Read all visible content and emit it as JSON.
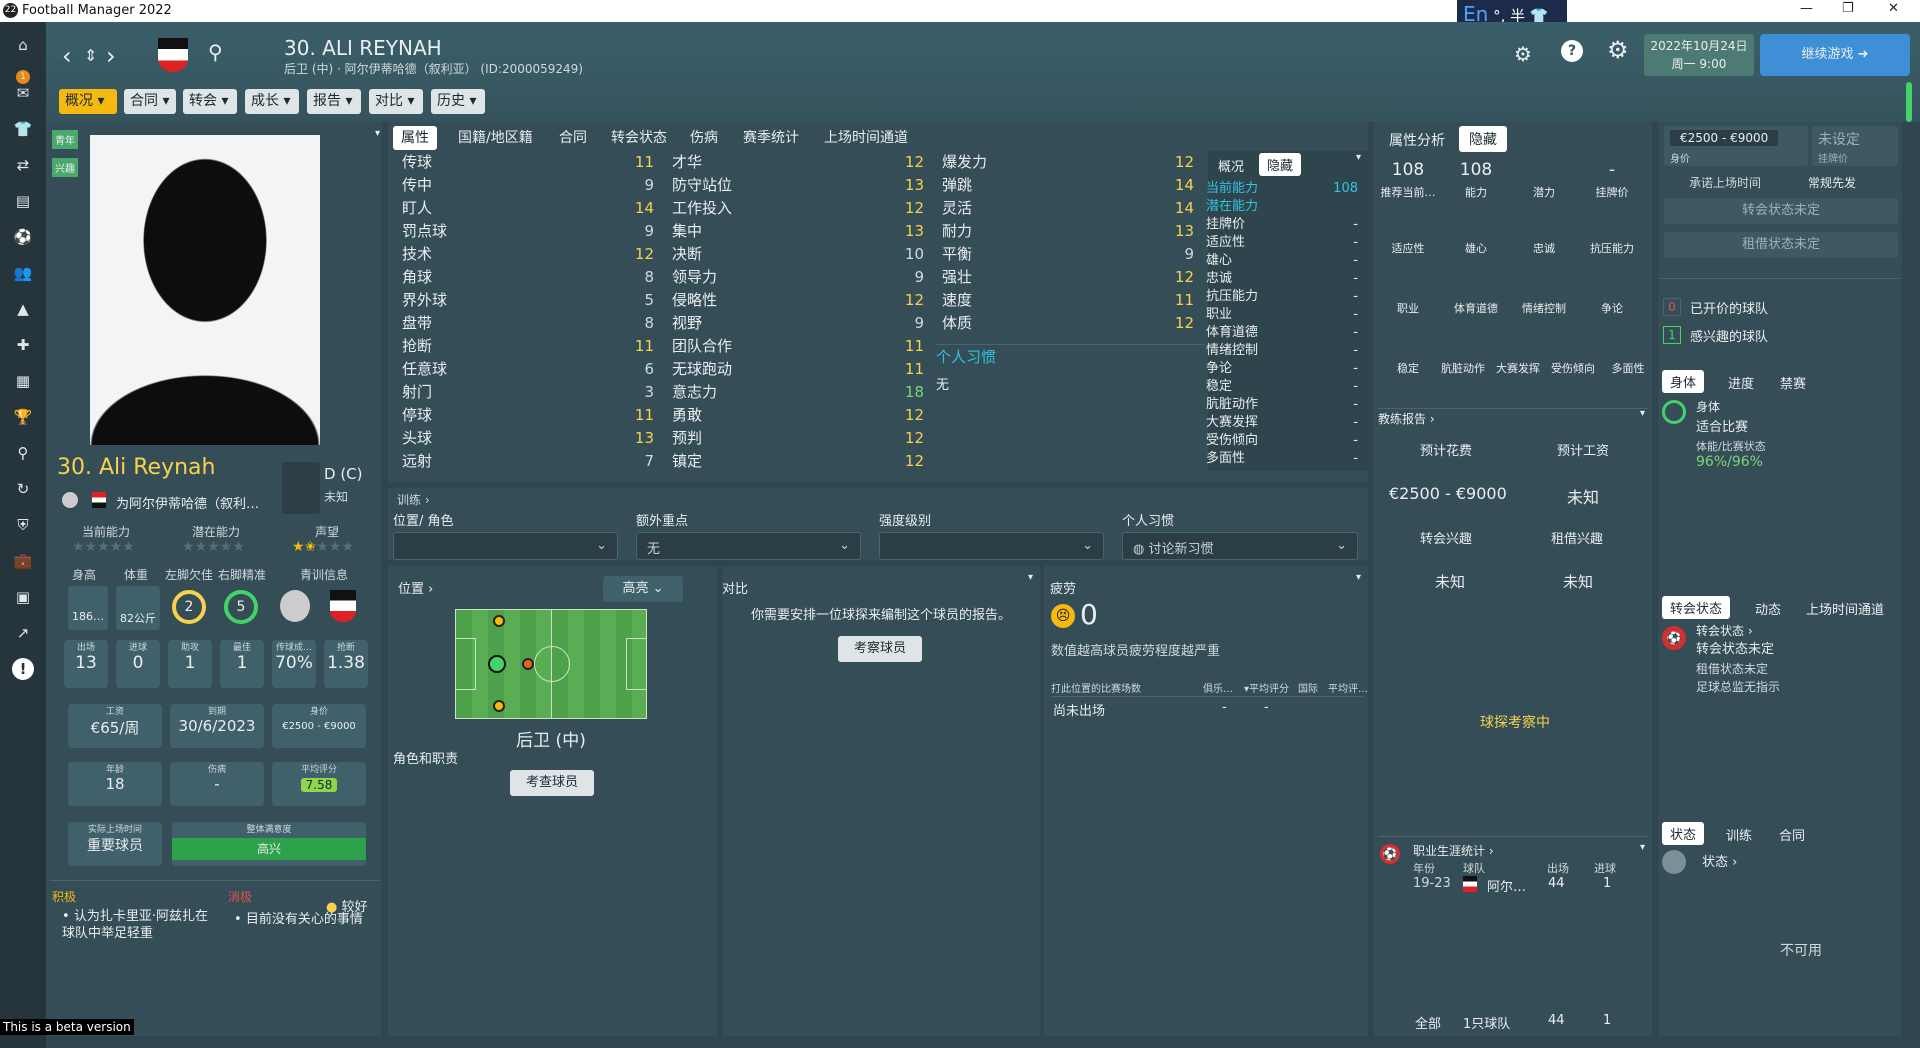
{
  "app": {
    "title": "Football Manager 2022",
    "logo": "22"
  },
  "ime": {
    "lang": "En",
    "marks": "°, 半"
  },
  "header": {
    "name": "30. ALI REYNAH",
    "subtitle": "后卫 (中) · 阿尔伊蒂哈德（叙利亚） (ID:2000059249)",
    "tabs": [
      "概况",
      "合同",
      "转会",
      "成长",
      "报告",
      "对比",
      "历史"
    ],
    "date": "2022年10月24日",
    "weekday": "周一 9:00",
    "continue": "继续游戏"
  },
  "left": {
    "tags": [
      "青年",
      "兴趣"
    ],
    "name": "30. Ali Reynah",
    "club": "为阿尔伊蒂哈德（叙利…",
    "pos": "D (C)",
    "pos_sub": "未知",
    "ability_labels": [
      "当前能力",
      "潜在能力",
      "声望"
    ],
    "stats_labels": [
      "身高",
      "体重",
      "左脚欠佳",
      "右脚精准",
      "青训信息"
    ],
    "height": "186…",
    "weight": "82公斤",
    "left_foot": "2",
    "right_foot": "5",
    "games": [
      {
        "l": "出场",
        "v": "13"
      },
      {
        "l": "进球",
        "v": "0"
      },
      {
        "l": "助攻",
        "v": "1"
      },
      {
        "l": "最佳",
        "v": "1"
      },
      {
        "l": "传球成…",
        "v": "70%"
      },
      {
        "l": "抢断",
        "v": "1.38"
      }
    ],
    "wage_l": "工资",
    "wage": "€65/周",
    "expiry_l": "到期",
    "expiry": "30/6/2023",
    "value_l": "身价",
    "value": "€2500 - €9000",
    "age_l": "年龄",
    "age": "18",
    "inj_l": "伤病",
    "inj": "-",
    "avg_l": "平均评分",
    "avg": "7.58",
    "time_l": "实际上场时间",
    "time": "重要球员",
    "happy_l": "整体满意度",
    "happy": "高兴",
    "pos_l": "积极",
    "pos_t": "认为扎卡里亚·阿兹扎在球队中举足轻重",
    "neg_l": "消极",
    "neg_t": "目前没有关心的事情",
    "mood": "较好",
    "beta": "This is a beta version"
  },
  "attrtabs": [
    "属性",
    "国籍/地区籍",
    "合同",
    "转会状态",
    "伤病",
    "赛季统计",
    "上场时间通道"
  ],
  "col1": [
    [
      "传球",
      "11"
    ],
    [
      "传中",
      "9"
    ],
    [
      "盯人",
      "14"
    ],
    [
      "罚点球",
      "9"
    ],
    [
      "技术",
      "12"
    ],
    [
      "角球",
      "8"
    ],
    [
      "界外球",
      "5"
    ],
    [
      "盘带",
      "8"
    ],
    [
      "抢断",
      "11"
    ],
    [
      "任意球",
      "6"
    ],
    [
      "射门",
      "3"
    ],
    [
      "停球",
      "11"
    ],
    [
      "头球",
      "13"
    ],
    [
      "远射",
      "7"
    ]
  ],
  "col2": [
    [
      "才华",
      "12"
    ],
    [
      "防守站位",
      "13"
    ],
    [
      "工作投入",
      "12"
    ],
    [
      "集中",
      "13"
    ],
    [
      "决断",
      "10"
    ],
    [
      "领导力",
      "9"
    ],
    [
      "侵略性",
      "12"
    ],
    [
      "视野",
      "9"
    ],
    [
      "团队合作",
      "11"
    ],
    [
      "无球跑动",
      "11"
    ],
    [
      "意志力",
      "18"
    ],
    [
      "勇敢",
      "12"
    ],
    [
      "预判",
      "12"
    ],
    [
      "镇定",
      "12"
    ]
  ],
  "col3": [
    [
      "爆发力",
      "12"
    ],
    [
      "弹跳",
      "14"
    ],
    [
      "灵活",
      "14"
    ],
    [
      "耐力",
      "13"
    ],
    [
      "平衡",
      "9"
    ],
    [
      "强壮",
      "12"
    ],
    [
      "速度",
      "11"
    ],
    [
      "体质",
      "12"
    ]
  ],
  "habits_l": "个人习惯",
  "habits": "无",
  "hidden": {
    "tabs": [
      "概况",
      "隐藏"
    ],
    "rows": [
      [
        "当前能力",
        "108"
      ],
      [
        "潜在能力",
        ""
      ],
      [
        "挂牌价",
        "-"
      ],
      [
        "适应性",
        "-"
      ],
      [
        "雄心",
        "-"
      ],
      [
        "忠诚",
        "-"
      ],
      [
        "抗压能力",
        "-"
      ],
      [
        "职业",
        "-"
      ],
      [
        "体育道德",
        "-"
      ],
      [
        "情绪控制",
        "-"
      ],
      [
        "争论",
        "-"
      ],
      [
        "稳定",
        "-"
      ],
      [
        "肮脏动作",
        "-"
      ],
      [
        "大赛发挥",
        "-"
      ],
      [
        "受伤倾向",
        "-"
      ],
      [
        "多面性",
        "-"
      ]
    ]
  },
  "training": {
    "title": "训练",
    "cols": [
      "位置/ 角色",
      "额外重点",
      "强度级别",
      "个人习惯"
    ],
    "vals": [
      "",
      "无",
      "",
      "讨论新习惯"
    ]
  },
  "position": {
    "title": "位置",
    "mode": "高亮",
    "role": "后卫 (中)",
    "role_l": "角色和职责",
    "btn": "考查球员"
  },
  "compare": {
    "title": "对比",
    "text": "你需要安排一位球探来编制这个球员的报告。",
    "btn": "考察球员"
  },
  "fatigue": {
    "title": "疲劳",
    "value": "0",
    "desc": "数值越高球员疲劳程度越严重",
    "cols": [
      "打此位置的比赛场数",
      "俱乐…",
      "平均评分",
      "国际",
      "平均评…"
    ],
    "row": [
      "尚未出场",
      "-",
      "-"
    ]
  },
  "analysis": {
    "tabs": [
      "属性分析",
      "隐藏"
    ],
    "top": [
      [
        "108",
        "推荐当前…"
      ],
      [
        "108",
        "能力"
      ],
      [
        "",
        "潜力"
      ],
      [
        "-",
        "挂牌价"
      ]
    ],
    "r2": [
      "适应性",
      "雄心",
      "忠诚",
      "抗压能力"
    ],
    "r3": [
      "职业",
      "体育道德",
      "情绪控制",
      "争论"
    ],
    "r4": [
      "稳定",
      "肮脏动作",
      "大赛发挥",
      "受伤倾向",
      "多面性"
    ]
  },
  "scout": {
    "title": "教练报告",
    "fee_l": "预计花费",
    "wage_l": "预计工资",
    "fee": "€2500 - €9000",
    "wage": "未知",
    "tr_l": "转会兴趣",
    "loan_l": "租借兴趣",
    "tr": "未知",
    "loan": "未知",
    "status": "球探考察中"
  },
  "career": {
    "title": "职业生涯统计",
    "cols": [
      "年份",
      "球队",
      "出场",
      "进球"
    ],
    "row": [
      "19-23",
      "阿尔…",
      "44",
      "1"
    ],
    "total": [
      "全部",
      "1只球队",
      "44",
      "1"
    ]
  },
  "right": {
    "price": "€2500 - €9000",
    "price_l": "身价",
    "unset": "未设定",
    "unset_l": "挂牌价",
    "promise": "承诺上场时间",
    "starter": "常规先发",
    "tr_status": "转会状态未定",
    "loan_status": "租借状态未定",
    "offered": "已开价的球队",
    "offered_n": "0",
    "interested": "感兴趣的球队",
    "interested_n": "1",
    "phys_tabs": [
      "身体",
      "进度",
      "禁赛"
    ],
    "phys": "身体",
    "fit": "适合比赛",
    "cond_l": "体能/比赛状态",
    "cond": "96%/96%",
    "st_tabs": [
      "转会状态",
      "动态",
      "上场时间通道"
    ],
    "st1": "转会状态",
    "st2": "转会状态未定",
    "st3": "租借状态未定",
    "st4": "足球总监无指示",
    "bt_tabs": [
      "状态",
      "训练",
      "合同"
    ],
    "state": "状态",
    "na": "不可用"
  }
}
